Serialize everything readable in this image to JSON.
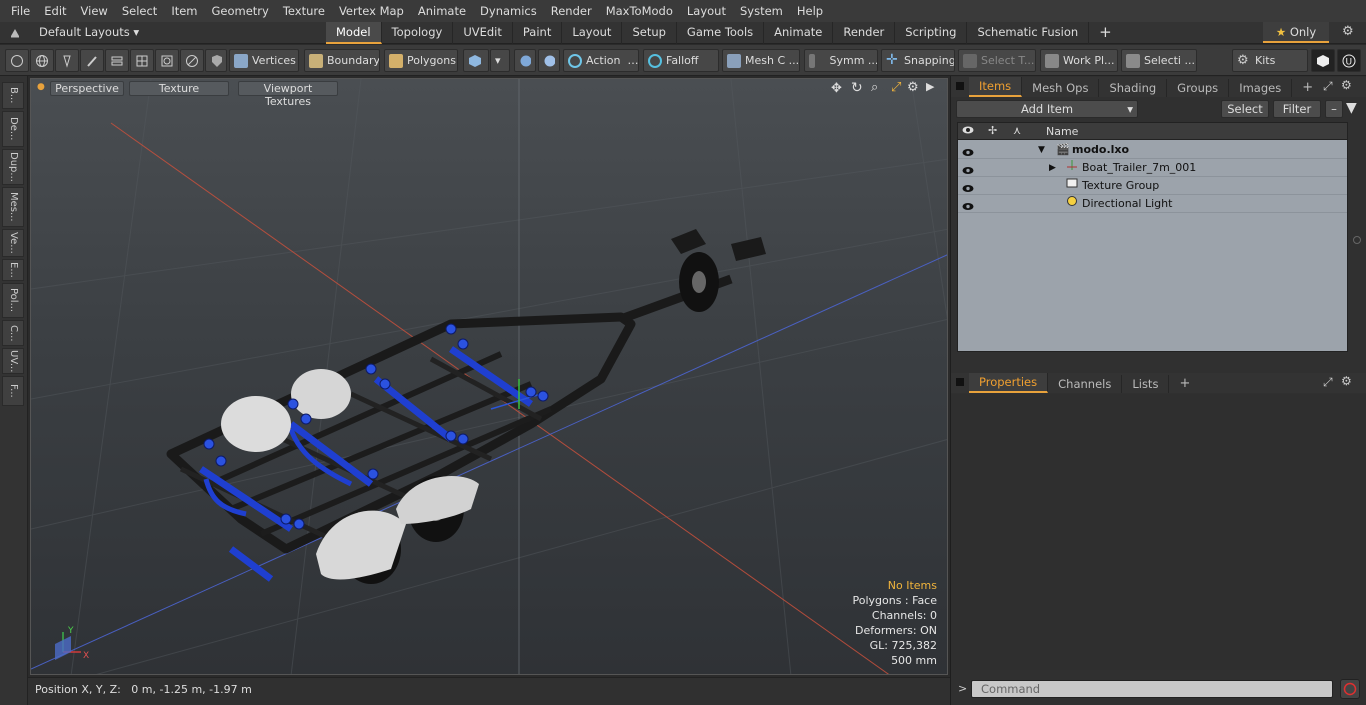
{
  "menu": [
    "File",
    "Edit",
    "View",
    "Select",
    "Item",
    "Geometry",
    "Texture",
    "Vertex Map",
    "Animate",
    "Dynamics",
    "Render",
    "MaxToModo",
    "Layout",
    "System",
    "Help"
  ],
  "layout_selector": "Default Layouts",
  "layout_tabs": [
    "Model",
    "Topology",
    "UVEdit",
    "Paint",
    "Layout",
    "Setup",
    "Game Tools",
    "Animate",
    "Render",
    "Scripting",
    "Schematic Fusion"
  ],
  "layout_active": "Model",
  "only_label": "Only",
  "toolbar": {
    "vertices": "Vertices",
    "boundary": "Boundary",
    "polygons": "Polygons",
    "action": "Action",
    "falloff": "Falloff",
    "mesh": "Mesh C ...",
    "symm": "Symm ...",
    "snapping": "Snapping",
    "select_t": "Select T...",
    "work_pl": "Work Pl...",
    "selecti": "Selecti ...",
    "kits": "Kits"
  },
  "left_tabs": [
    "B...",
    "De...",
    "Dup...",
    "Mes...",
    "Ve...",
    "E...",
    "Pol...",
    "C...",
    "UV...",
    "F..."
  ],
  "viewport": {
    "view_mode": "Perspective",
    "shading": "Texture",
    "textures": "Viewport Textures",
    "axis_y": "Y",
    "axis_x": "X"
  },
  "stats": {
    "items": "No Items",
    "polygons": "Polygons : Face",
    "channels": "Channels: 0",
    "deformers": "Deformers: ON",
    "gl": "GL: 725,382",
    "scale": "500 mm"
  },
  "status": "Position X, Y, Z:   0 m, -1.25 m, -1.97 m",
  "items_panel": {
    "tabs": [
      "Items",
      "Mesh Ops",
      "Shading",
      "Groups",
      "Images"
    ],
    "add_item": "Add Item",
    "select": "Select",
    "filter": "Filter",
    "name_header": "Name",
    "tree": [
      {
        "name": "modo.lxo"
      },
      {
        "name": "Boat_Trailer_7m_001"
      },
      {
        "name": "Texture Group"
      },
      {
        "name": "Directional Light"
      }
    ]
  },
  "properties_panel": {
    "tabs": [
      "Properties",
      "Channels",
      "Lists"
    ]
  },
  "command_placeholder": "Command",
  "colors": {
    "accent": "#e8a23c",
    "trailer_blue": "#1f3fd0"
  }
}
